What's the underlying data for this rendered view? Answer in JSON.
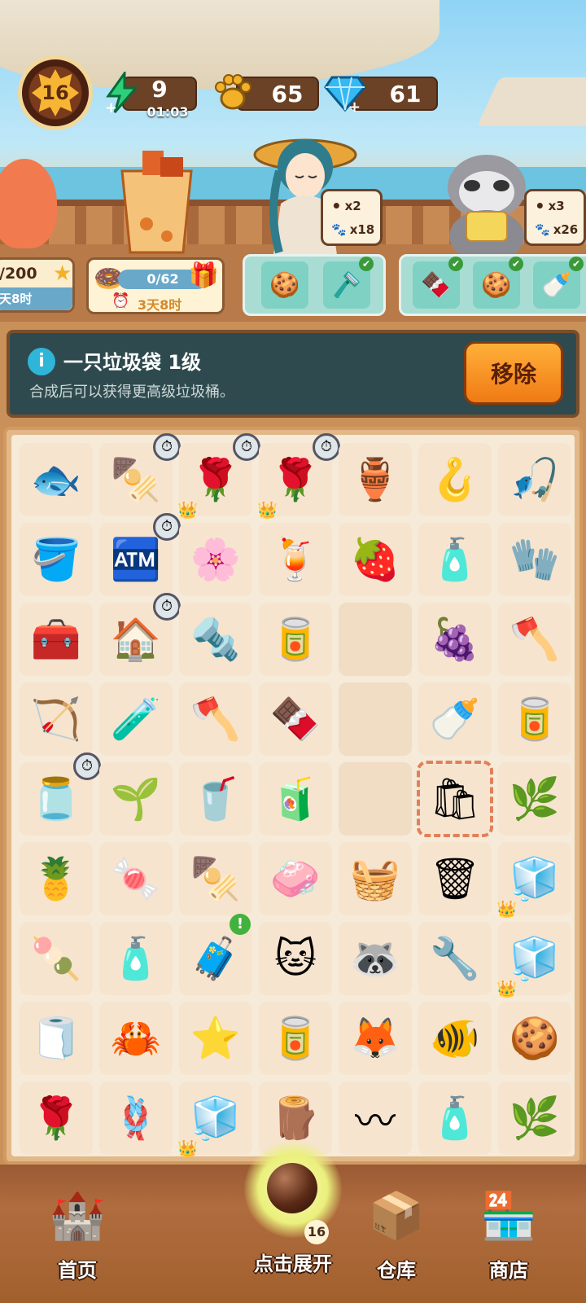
{
  "hud": {
    "level": "16",
    "energy": {
      "value": "9",
      "timer": "01:03",
      "icon": "lightning-icon",
      "color": "#2fcf7a"
    },
    "paws": {
      "value": "65",
      "icon": "paw-icon",
      "color": "#f3b12a"
    },
    "gems": {
      "value": "61",
      "icon": "diamond-icon",
      "color": "#36b8f2"
    }
  },
  "requests": [
    {
      "items": [
        {
          "icon": "ball-icon",
          "count": "x2"
        },
        {
          "icon": "paw-icon",
          "count": "x18"
        }
      ]
    },
    {
      "items": [
        {
          "icon": "ball-icon",
          "count": "x3"
        },
        {
          "icon": "paw-icon",
          "count": "x26"
        }
      ]
    }
  ],
  "events": {
    "left": {
      "progress": "/200",
      "time": "天8时"
    },
    "middle": {
      "progress": "0/62",
      "time": "3天8时"
    }
  },
  "orders": [
    {
      "slots": [
        {
          "icon": "cookies-icon",
          "done": false
        },
        {
          "icon": "razor-icon",
          "done": true
        }
      ]
    },
    {
      "slots": [
        {
          "icon": "chocolate-icon",
          "done": true
        },
        {
          "icon": "cookies-icon",
          "done": true
        },
        {
          "icon": "bottle-icon",
          "done": true
        }
      ]
    }
  ],
  "info": {
    "title": "一只垃圾袋 1级",
    "description": "合成后可以获得更高级垃圾桶。",
    "remove_label": "移除"
  },
  "board": {
    "rows": [
      [
        {
          "icon": "fish-icon",
          "glyph": "🐟"
        },
        {
          "icon": "grill-icon",
          "glyph": "🍢",
          "timer": true
        },
        {
          "icon": "rose-pot-icon",
          "glyph": "🌹",
          "timer": true,
          "crown": true
        },
        {
          "icon": "rose-pot-icon",
          "glyph": "🌹",
          "timer": true,
          "crown": true
        },
        {
          "icon": "vase-icon",
          "glyph": "🏺"
        },
        {
          "icon": "hanger-icon",
          "glyph": "🪝"
        },
        {
          "icon": "lure-icon",
          "glyph": "🎣"
        }
      ],
      [
        {
          "icon": "bucket-icon",
          "glyph": "🪣"
        },
        {
          "icon": "vending-machine-icon",
          "glyph": "🏧",
          "timer": true
        },
        {
          "icon": "petal-icon",
          "glyph": "🌸"
        },
        {
          "icon": "watermelon-juice-icon",
          "glyph": "🍹"
        },
        {
          "icon": "jelly-cup-icon",
          "glyph": "🍓"
        },
        {
          "icon": "spray-bottle-icon",
          "glyph": "🧴"
        },
        {
          "icon": "glove-icon",
          "glyph": "🧤"
        }
      ],
      [
        {
          "icon": "toolbox-icon",
          "glyph": "🧰"
        },
        {
          "icon": "house-icon",
          "glyph": "🏠",
          "timer": true
        },
        {
          "icon": "screw-icon",
          "glyph": "🔩"
        },
        {
          "icon": "paint-can-icon",
          "glyph": "🥫"
        },
        {
          "icon": "empty",
          "glyph": ""
        },
        {
          "icon": "berries-icon",
          "glyph": "🍇"
        },
        {
          "icon": "hatchet-icon",
          "glyph": "🪓"
        }
      ],
      [
        {
          "icon": "bow-icon",
          "glyph": "🏹"
        },
        {
          "icon": "glass-case-icon",
          "glyph": "🧪"
        },
        {
          "icon": "axe-icon",
          "glyph": "🪓"
        },
        {
          "icon": "chocolate-icon",
          "glyph": "🍫"
        },
        {
          "icon": "empty",
          "glyph": ""
        },
        {
          "icon": "bottle-icon",
          "glyph": "🍼"
        },
        {
          "icon": "can-icon",
          "glyph": "🥫"
        }
      ],
      [
        {
          "icon": "jar-icon",
          "glyph": "🫙",
          "timer": true
        },
        {
          "icon": "bean-sprout-icon",
          "glyph": "🌱"
        },
        {
          "icon": "soda-can-icon",
          "glyph": "🥤"
        },
        {
          "icon": "juice-cup-icon",
          "glyph": "🧃"
        },
        {
          "icon": "empty",
          "glyph": ""
        },
        {
          "icon": "trash-bag-icon",
          "glyph": "🛍",
          "selected": true
        },
        {
          "icon": "herb-icon",
          "glyph": "🌿"
        }
      ],
      [
        {
          "icon": "pineapple-drink-icon",
          "glyph": "🍍"
        },
        {
          "icon": "candy-icon",
          "glyph": "🍬"
        },
        {
          "icon": "skewer-tray-icon",
          "glyph": "🍢"
        },
        {
          "icon": "soap-icon",
          "glyph": "🧼"
        },
        {
          "icon": "detergent-bag-icon",
          "glyph": "🧺"
        },
        {
          "icon": "trash-bin-icon",
          "glyph": "🗑"
        },
        {
          "icon": "cooler-box-icon",
          "glyph": "🧊",
          "crown": true
        }
      ],
      [
        {
          "icon": "meatballs-icon",
          "glyph": "🍡"
        },
        {
          "icon": "detergent-jug-icon",
          "glyph": "🧴"
        },
        {
          "icon": "chest-icon",
          "glyph": "🧳",
          "notice": true
        },
        {
          "icon": "cat-keychain-icon",
          "glyph": "🐱"
        },
        {
          "icon": "raccoon-keychain-icon",
          "glyph": "🦝"
        },
        {
          "icon": "pipe-icon",
          "glyph": "🔧"
        },
        {
          "icon": "cooler-box-icon",
          "glyph": "🧊",
          "crown": true
        }
      ],
      [
        {
          "icon": "towel-icon",
          "glyph": "🧻"
        },
        {
          "icon": "crab-icon",
          "glyph": "🦀"
        },
        {
          "icon": "starfish-icon",
          "glyph": "⭐"
        },
        {
          "icon": "paint-cans-icon",
          "glyph": "🥫"
        },
        {
          "icon": "fox-keychain-icon",
          "glyph": "🦊"
        },
        {
          "icon": "fish-figure-icon",
          "glyph": "🐠"
        },
        {
          "icon": "paw-cookies-icon",
          "glyph": "🍪"
        }
      ],
      [
        {
          "icon": "rose-pot-icon",
          "glyph": "🌹"
        },
        {
          "icon": "rope-icon",
          "glyph": "🪢"
        },
        {
          "icon": "cooler-box-icon",
          "glyph": "🧊",
          "crown": true
        },
        {
          "icon": "wood-plank-icon",
          "glyph": "🪵"
        },
        {
          "icon": "string-icon",
          "glyph": "〰"
        },
        {
          "icon": "detergent-jug-icon",
          "glyph": "🧴"
        },
        {
          "icon": "herb-sprig-icon",
          "glyph": "🌿"
        }
      ]
    ]
  },
  "nav": {
    "home_label": "首页",
    "expand_label": "点击展开",
    "expand_count": "16",
    "storage_label": "仓库",
    "shop_label": "商店"
  }
}
